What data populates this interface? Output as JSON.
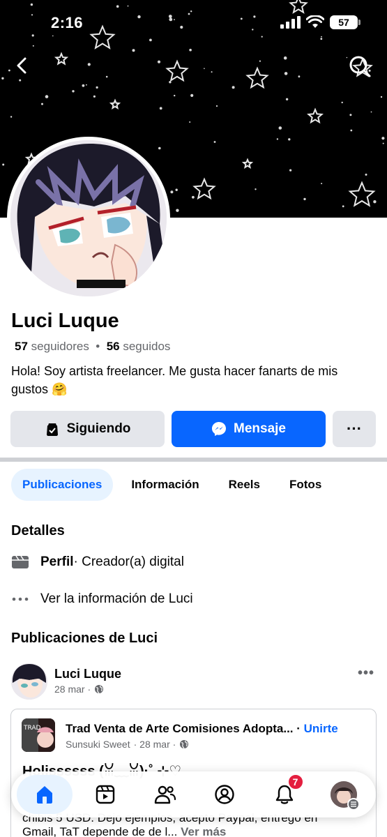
{
  "status": {
    "time": "2:16",
    "battery": "57"
  },
  "profile": {
    "name": "Luci Luque",
    "followers_count": "57",
    "followers_label": "seguidores",
    "separator": "•",
    "following_count": "56",
    "following_label": "seguidos",
    "bio": "Hola! Soy artista freelancer. Me gusta hacer fanarts de mis gustos 🤗"
  },
  "actions": {
    "following_label": "Siguiendo",
    "message_label": "Mensaje",
    "more_label": "···"
  },
  "tabs": [
    {
      "label": "Publicaciones",
      "active": true
    },
    {
      "label": "Información",
      "active": false
    },
    {
      "label": "Reels",
      "active": false
    },
    {
      "label": "Fotos",
      "active": false
    }
  ],
  "details": {
    "title": "Detalles",
    "profile_label": "Perfil",
    "profile_value": " · Creador(a) digital",
    "info_link": "Ver la información de Luci"
  },
  "posts_section": {
    "title": "Publicaciones de Luci"
  },
  "post": {
    "author": "Luci Luque",
    "date": "28 mar ·",
    "menu": "•••",
    "shared": {
      "group_title": "Trad Venta de Arte Comisiones Adopta...",
      "join_sep": " · ",
      "join_label": "Unirte",
      "sub_author": "Sunsuki Sweet",
      "sub_date": " · 28 mar ·",
      "text_line1": "Holissssss (ꈍ﹏ꈍ)·˚ ⊹♡",
      "text_line2": "chibis 5 USD. Dejo ejemplos, acepto Paypal, entrego en",
      "text_line3": "Gmail, TaT depende de de l...",
      "see_more": "Ver más"
    }
  },
  "bottom_nav": {
    "items": [
      "home-icon",
      "video-icon",
      "friends-icon",
      "profile-icon",
      "bell-icon",
      "menu-avatar"
    ],
    "notifications_badge": "7"
  },
  "colors": {
    "accent": "#0866ff",
    "badge": "#e41e3f",
    "tab_active_bg": "#e7f3ff"
  }
}
